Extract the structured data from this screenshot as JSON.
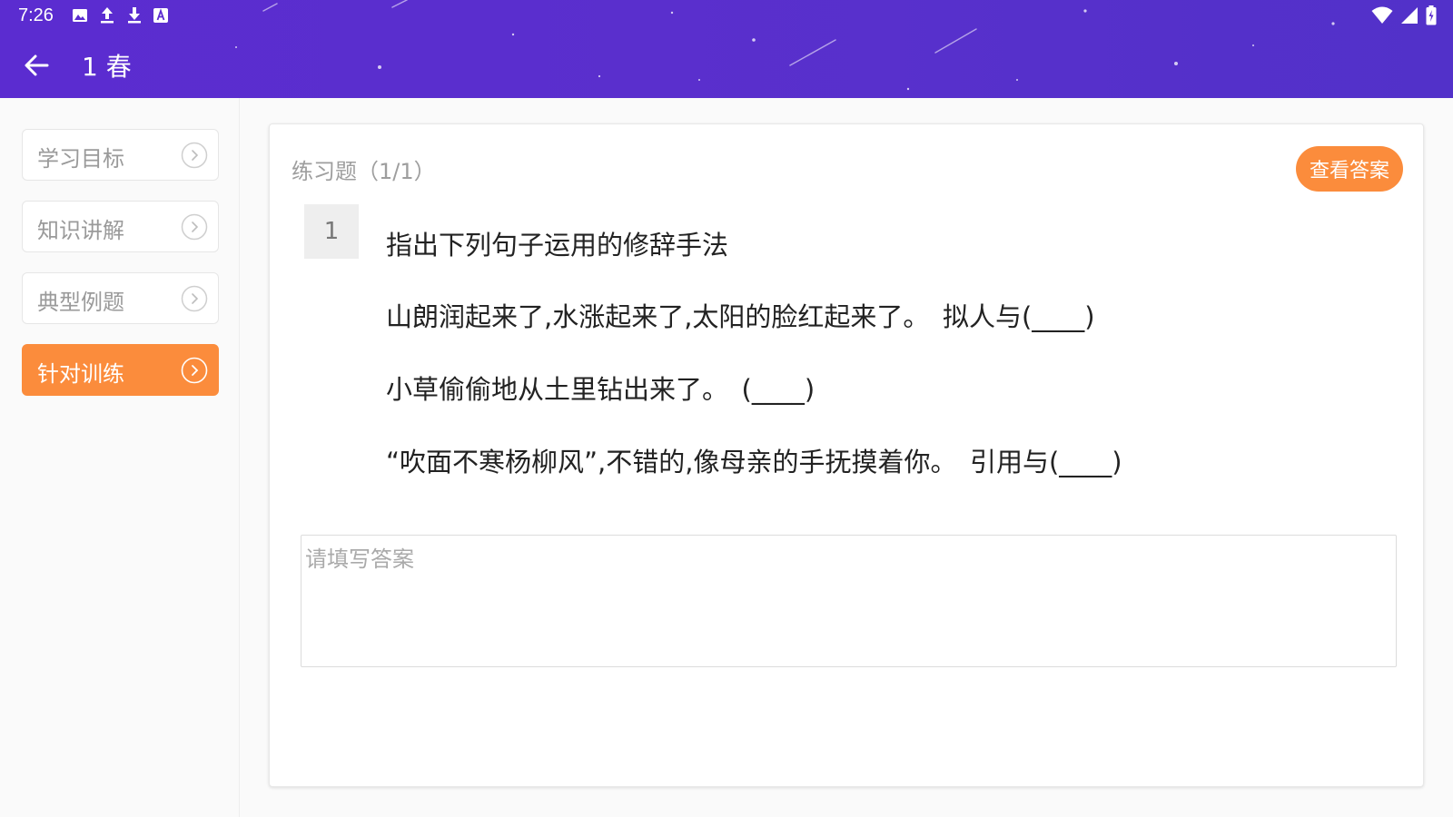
{
  "status_bar": {
    "time": "7:26",
    "left_icons": [
      "image-icon",
      "upload-icon",
      "download-icon",
      "a-box-icon"
    ],
    "right_icons": [
      "wifi-icon",
      "signal-icon",
      "battery-icon"
    ]
  },
  "header": {
    "title": "1 春",
    "back_icon": "arrow-left-icon",
    "color": "#5a2fcd"
  },
  "sidebar": {
    "items": [
      {
        "label": "学习目标",
        "active": false
      },
      {
        "label": "知识讲解",
        "active": false
      },
      {
        "label": "典型例题",
        "active": false
      },
      {
        "label": "针对训练",
        "active": true
      }
    ],
    "accent": "#fb8c3c"
  },
  "card": {
    "title": "练习题（1/1）",
    "answer_button": "查看答案",
    "question_number": "1",
    "question_lines": [
      "指出下列句子运用的修辞手法",
      "山朗润起来了,水涨起来了,太阳的脸红起来了。　拟人与(____)",
      "小草偷偷地从土里钻出来了。　(____)",
      "“吹面不寒杨柳风”,不错的,像母亲的手抚摸着你。　引用与(____)"
    ],
    "answer_placeholder": "请填写答案",
    "answer_value": ""
  }
}
